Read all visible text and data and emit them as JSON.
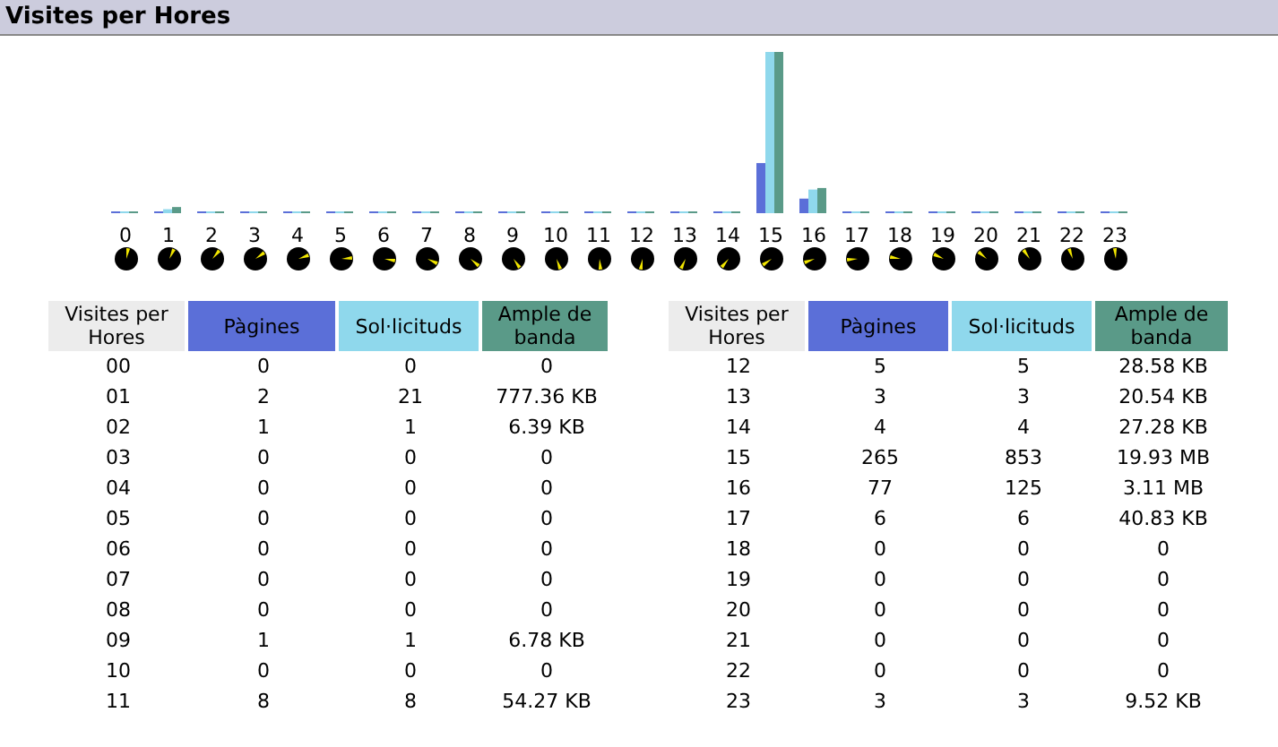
{
  "header": {
    "title": "Visites per Hores"
  },
  "chart": {
    "hour_labels": [
      "0",
      "1",
      "2",
      "3",
      "4",
      "5",
      "6",
      "7",
      "8",
      "9",
      "10",
      "11",
      "12",
      "13",
      "14",
      "15",
      "16",
      "17",
      "18",
      "19",
      "20",
      "21",
      "22",
      "23"
    ]
  },
  "tables": [
    {
      "columns": [
        "Visites per Hores",
        "Pàgines",
        "Sol·licituds",
        "Ample de banda"
      ],
      "rows": [
        [
          "00",
          "0",
          "0",
          "0"
        ],
        [
          "01",
          "2",
          "21",
          "777.36 KB"
        ],
        [
          "02",
          "1",
          "1",
          "6.39 KB"
        ],
        [
          "03",
          "0",
          "0",
          "0"
        ],
        [
          "04",
          "0",
          "0",
          "0"
        ],
        [
          "05",
          "0",
          "0",
          "0"
        ],
        [
          "06",
          "0",
          "0",
          "0"
        ],
        [
          "07",
          "0",
          "0",
          "0"
        ],
        [
          "08",
          "0",
          "0",
          "0"
        ],
        [
          "09",
          "1",
          "1",
          "6.78 KB"
        ],
        [
          "10",
          "0",
          "0",
          "0"
        ],
        [
          "11",
          "8",
          "8",
          "54.27 KB"
        ]
      ]
    },
    {
      "columns": [
        "Visites per Hores",
        "Pàgines",
        "Sol·licituds",
        "Ample de banda"
      ],
      "rows": [
        [
          "12",
          "5",
          "5",
          "28.58 KB"
        ],
        [
          "13",
          "3",
          "3",
          "20.54 KB"
        ],
        [
          "14",
          "4",
          "4",
          "27.28 KB"
        ],
        [
          "15",
          "265",
          "853",
          "19.93 MB"
        ],
        [
          "16",
          "77",
          "125",
          "3.11 MB"
        ],
        [
          "17",
          "6",
          "6",
          "40.83 KB"
        ],
        [
          "18",
          "0",
          "0",
          "0"
        ],
        [
          "19",
          "0",
          "0",
          "0"
        ],
        [
          "20",
          "0",
          "0",
          "0"
        ],
        [
          "21",
          "0",
          "0",
          "0"
        ],
        [
          "22",
          "0",
          "0",
          "0"
        ],
        [
          "23",
          "3",
          "3",
          "9.52 KB"
        ]
      ]
    }
  ]
}
